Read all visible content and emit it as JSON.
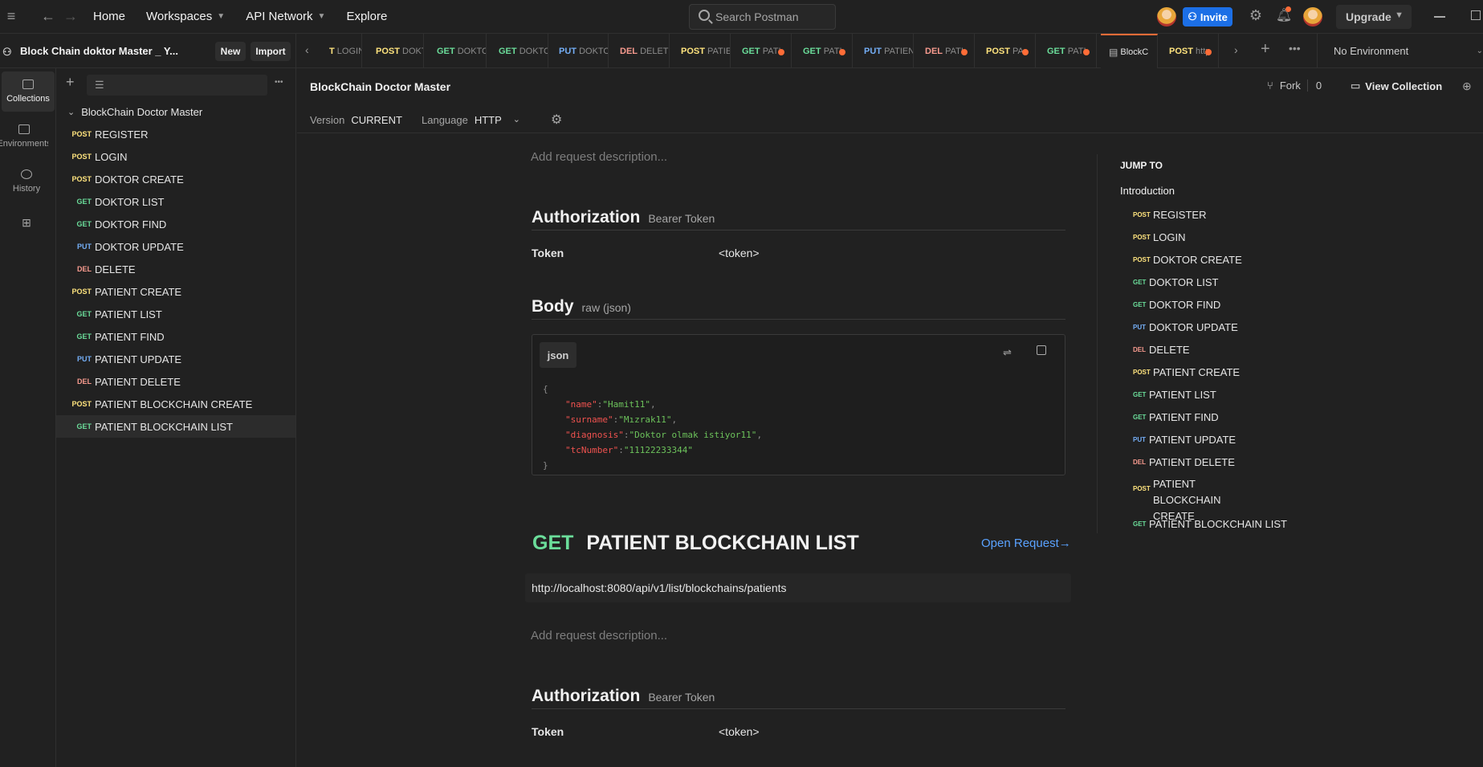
{
  "topbar": {
    "nav": [
      "Home",
      "Workspaces",
      "API Network",
      "Explore"
    ],
    "search_placeholder": "Search Postman",
    "invite_label": "Invite",
    "upgrade_label": "Upgrade"
  },
  "workspace": {
    "title": "Block Chain doktor Master _ Y...",
    "new_label": "New",
    "import_label": "Import"
  },
  "tabs": [
    {
      "method": "",
      "label": "LOGIN",
      "partial": "T"
    },
    {
      "method": "POST",
      "label": "DOKTOR"
    },
    {
      "method": "GET",
      "label": "DOKTOR"
    },
    {
      "method": "GET",
      "label": "DOKTOR"
    },
    {
      "method": "PUT",
      "label": "DOKTOR"
    },
    {
      "method": "DEL",
      "label": "DELETE"
    },
    {
      "method": "POST",
      "label": "PATIENT"
    },
    {
      "method": "GET",
      "label": "PATI"
    },
    {
      "method": "GET",
      "label": "PATI"
    },
    {
      "method": "PUT",
      "label": "PATIENT"
    },
    {
      "method": "DEL",
      "label": "PATI"
    },
    {
      "method": "POST",
      "label": "PA"
    },
    {
      "method": "GET",
      "label": "PATI"
    },
    {
      "method": "",
      "label": "BlockC"
    },
    {
      "method": "POST",
      "label": "http"
    }
  ],
  "environment": "No Environment",
  "rail": [
    {
      "label": "Collections"
    },
    {
      "label": "Environments"
    },
    {
      "label": "History"
    }
  ],
  "collection": {
    "name": "BlockChain Doctor Master",
    "items": [
      {
        "method": "POST",
        "name": "REGISTER"
      },
      {
        "method": "POST",
        "name": "LOGIN"
      },
      {
        "method": "POST",
        "name": "DOKTOR CREATE"
      },
      {
        "method": "GET",
        "name": "DOKTOR LIST"
      },
      {
        "method": "GET",
        "name": "DOKTOR FIND"
      },
      {
        "method": "PUT",
        "name": "DOKTOR UPDATE"
      },
      {
        "method": "DEL",
        "name": "DELETE"
      },
      {
        "method": "POST",
        "name": "PATIENT CREATE"
      },
      {
        "method": "GET",
        "name": "PATIENT LIST"
      },
      {
        "method": "GET",
        "name": "PATIENT FIND"
      },
      {
        "method": "PUT",
        "name": "PATIENT UPDATE"
      },
      {
        "method": "DEL",
        "name": "PATIENT DELETE"
      },
      {
        "method": "POST",
        "name": "PATIENT BLOCKCHAIN CREATE"
      },
      {
        "method": "GET",
        "name": "PATIENT BLOCKCHAIN LIST"
      }
    ]
  },
  "doc": {
    "title": "BlockChain Doctor Master",
    "fork_label": "Fork",
    "fork_count": "0",
    "view_collection": "View Collection",
    "version_label": "Version",
    "version_value": "CURRENT",
    "language_label": "Language",
    "language_value": "HTTP",
    "add_desc": "Add request description...",
    "auth_heading": "Authorization",
    "auth_type": "Bearer Token",
    "token_label": "Token",
    "token_value": "<token>",
    "body_heading": "Body",
    "body_type": "raw (json)",
    "code_lang": "json",
    "code": [
      {
        "key": "\"name\"",
        "val": "\"Hamit11\""
      },
      {
        "key": "\"surname\"",
        "val": "\"Mızrak11\""
      },
      {
        "key": "\"diagnosis\"",
        "val": "\"Doktor olmak istiyor11\""
      },
      {
        "key": "\"tcNumber\"",
        "val": "\"11122233344\""
      }
    ],
    "request_method": "GET",
    "request_name": "PATIENT BLOCKCHAIN LIST",
    "open_request": "Open Request→",
    "request_url": "http://localhost:8080/api/v1/list/blockchains/patients"
  },
  "jump_to": {
    "heading": "JUMP TO",
    "intro": "Introduction",
    "items": [
      {
        "method": "POST",
        "name": "REGISTER"
      },
      {
        "method": "POST",
        "name": "LOGIN"
      },
      {
        "method": "POST",
        "name": "DOKTOR CREATE"
      },
      {
        "method": "GET",
        "name": "DOKTOR LIST"
      },
      {
        "method": "GET",
        "name": "DOKTOR FIND"
      },
      {
        "method": "PUT",
        "name": "DOKTOR UPDATE"
      },
      {
        "method": "DEL",
        "name": "DELETE"
      },
      {
        "method": "POST",
        "name": "PATIENT CREATE"
      },
      {
        "method": "GET",
        "name": "PATIENT LIST"
      },
      {
        "method": "GET",
        "name": "PATIENT FIND"
      },
      {
        "method": "PUT",
        "name": "PATIENT UPDATE"
      },
      {
        "method": "DEL",
        "name": "PATIENT DELETE"
      },
      {
        "method": "POST",
        "name": "PATIENT BLOCKCHAIN CREATE"
      },
      {
        "method": "GET",
        "name": "PATIENT BLOCKCHAIN LIST"
      }
    ]
  }
}
